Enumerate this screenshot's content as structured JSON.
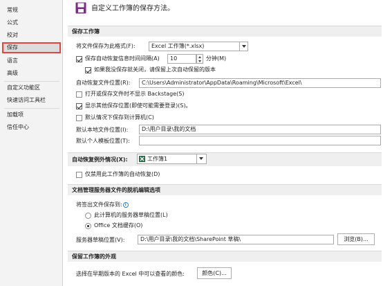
{
  "sidebar": {
    "items": [
      {
        "label": "常规"
      },
      {
        "label": "公式"
      },
      {
        "label": "校对"
      },
      {
        "label": "保存"
      },
      {
        "label": "语言"
      },
      {
        "label": "高级"
      },
      {
        "label": "自定义功能区"
      },
      {
        "label": "快速访问工具栏"
      },
      {
        "label": "加载项"
      },
      {
        "label": "信任中心"
      }
    ],
    "active": "保存"
  },
  "header": {
    "title": "自定义工作簿的保存方法。"
  },
  "save_workbooks": {
    "section_title": "保存工作簿",
    "format_label": "将文件保存为此格式(F):",
    "format_value": "Excel 工作簿(*.xlsx)",
    "autorecover_label": "保存自动恢复信息时间间隔(A)",
    "autorecover_checked": true,
    "autorecover_minutes": "10",
    "minutes_label": "分钟(M)",
    "keep_last_label": "如果我没保存就关闭，请保留上次自动保留的版本",
    "keep_last_checked": true,
    "autorecover_location_label": "自动恢复文件位置(R):",
    "autorecover_location_value": "C:\\Users\\Administrator\\AppData\\Roaming\\Microsoft\\Excel\\",
    "no_backstage_label": "打开或保存文件时不显示 Backstage(S)",
    "no_backstage_checked": false,
    "show_other_label": "显示其他保存位置(即使可能需要登录)(S)。",
    "show_other_checked": true,
    "save_to_computer_label": "默认情况下保存到计算机(C)",
    "save_to_computer_checked": false,
    "default_local_label": "默认本地文件位置(I):",
    "default_local_value": "D:\\用户目录\\我的文档",
    "default_template_label": "默认个人模板位置(T):",
    "default_template_value": ""
  },
  "autorecover_exceptions": {
    "label": "自动恢复例外情况(X):",
    "workbook_value": "工作簿1",
    "disable_label": "仅禁用此工作簿的自动恢复(D)",
    "disable_checked": false
  },
  "offline_editing": {
    "section_title": "文档管理服务器文件的脱机编辑选项",
    "save_checked_out_label": "将签出文件保存到:",
    "info_glyph": "i",
    "option_server_label": "此计算机的服务器草稿位置(L)",
    "option_cache_label": "Office 文档缓存(O)",
    "selected_option": "cache",
    "server_drafts_label": "服务器草稿位置(V):",
    "server_drafts_value": "D:\\用户目录\\我的文档\\SharePoint 草稿\\",
    "browse_label": "浏览(B)..."
  },
  "preserve_appearance": {
    "section_title": "保留工作簿的外观",
    "colors_label": "选择在早期版本的 Excel 中可以查看的颜色:",
    "colors_button_label": "颜色(C)..."
  },
  "colors": {
    "accent_red": "#e8413b",
    "save_icon": "#7b2d86",
    "excel_green": "#217346",
    "info_blue": "#2b7cd3"
  }
}
